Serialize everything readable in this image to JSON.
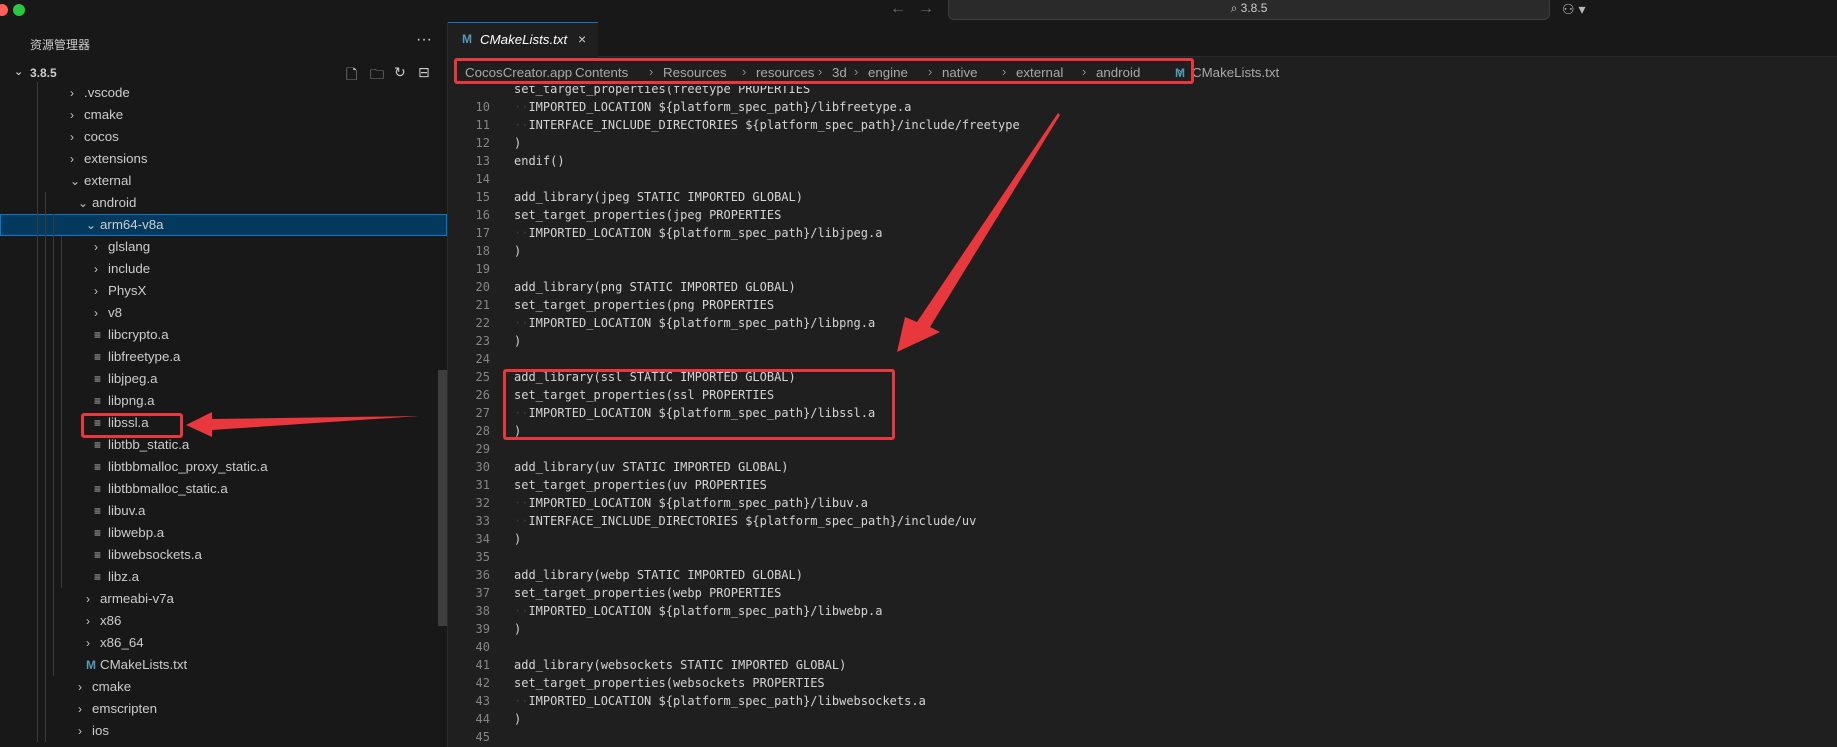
{
  "titlebar": {
    "search_text": "⌕ 3.8.5",
    "back_icon": "arrow-left-icon",
    "forward_icon": "arrow-right-icon",
    "copilot_icon": "copilot-icon",
    "copilot_glyph": "⚇ ▾"
  },
  "sidebar": {
    "header": "资源管理器",
    "more_glyph": "···",
    "root_label": "3.8.5",
    "toolbar_glyphs": [
      "🗋",
      "🗀",
      "↻",
      "⊟"
    ],
    "tree": [
      {
        "label": ".vscode",
        "type": "folder",
        "expanded": false
      },
      {
        "label": "cmake",
        "type": "folder",
        "expanded": false
      },
      {
        "label": "cocos",
        "type": "folder",
        "expanded": false
      },
      {
        "label": "extensions",
        "type": "folder",
        "expanded": false
      },
      {
        "label": "external",
        "type": "folder",
        "expanded": true
      },
      {
        "label": "android",
        "type": "folder",
        "expanded": true
      },
      {
        "label": "arm64-v8a",
        "type": "folder",
        "expanded": true,
        "selected": true
      },
      {
        "label": "glslang",
        "type": "folder",
        "expanded": false
      },
      {
        "label": "include",
        "type": "folder",
        "expanded": false
      },
      {
        "label": "PhysX",
        "type": "folder",
        "expanded": false
      },
      {
        "label": "v8",
        "type": "folder",
        "expanded": false
      },
      {
        "label": "libcrypto.a",
        "type": "file"
      },
      {
        "label": "libfreetype.a",
        "type": "file"
      },
      {
        "label": "libjpeg.a",
        "type": "file"
      },
      {
        "label": "libpng.a",
        "type": "file"
      },
      {
        "label": "libssl.a",
        "type": "file"
      },
      {
        "label": "libtbb_static.a",
        "type": "file"
      },
      {
        "label": "libtbbmalloc_proxy_static.a",
        "type": "file"
      },
      {
        "label": "libtbbmalloc_static.a",
        "type": "file"
      },
      {
        "label": "libuv.a",
        "type": "file"
      },
      {
        "label": "libwebp.a",
        "type": "file"
      },
      {
        "label": "libwebsockets.a",
        "type": "file"
      },
      {
        "label": "libz.a",
        "type": "file"
      },
      {
        "label": "armeabi-v7a",
        "type": "folder",
        "expanded": false
      },
      {
        "label": "x86",
        "type": "folder",
        "expanded": false
      },
      {
        "label": "x86_64",
        "type": "folder",
        "expanded": false
      },
      {
        "label": "CMakeLists.txt",
        "type": "cmake"
      },
      {
        "label": "cmake",
        "type": "folder",
        "expanded": false
      },
      {
        "label": "emscripten",
        "type": "folder",
        "expanded": false
      },
      {
        "label": "ios",
        "type": "folder",
        "expanded": false
      }
    ]
  },
  "editor": {
    "tab": {
      "icon_glyph": "M",
      "label": "CMakeLists.txt",
      "close_glyph": "×"
    },
    "breadcrumb": [
      "CocosCreator.app",
      "Contents",
      "Resources",
      "resources",
      "3d",
      "engine",
      "native",
      "external",
      "android",
      "CMakeLists.txt"
    ],
    "breadcrumb_sep": "›",
    "breadcrumb_file_icon": "M",
    "lines": [
      {
        "num": "",
        "indent": false,
        "text": "set_target_properties(freetype PROPERTIES"
      },
      {
        "num": "10",
        "indent": true,
        "text": "IMPORTED_LOCATION ${platform_spec_path}/libfreetype.a"
      },
      {
        "num": "11",
        "indent": true,
        "text": "INTERFACE_INCLUDE_DIRECTORIES ${platform_spec_path}/include/freetype"
      },
      {
        "num": "12",
        "indent": false,
        "text": ")"
      },
      {
        "num": "13",
        "indent": false,
        "text": "endif()"
      },
      {
        "num": "14",
        "indent": false,
        "text": ""
      },
      {
        "num": "15",
        "indent": false,
        "text": "add_library(jpeg STATIC IMPORTED GLOBAL)"
      },
      {
        "num": "16",
        "indent": false,
        "text": "set_target_properties(jpeg PROPERTIES"
      },
      {
        "num": "17",
        "indent": true,
        "text": "IMPORTED_LOCATION ${platform_spec_path}/libjpeg.a"
      },
      {
        "num": "18",
        "indent": false,
        "text": ")"
      },
      {
        "num": "19",
        "indent": false,
        "text": ""
      },
      {
        "num": "20",
        "indent": false,
        "text": "add_library(png STATIC IMPORTED GLOBAL)"
      },
      {
        "num": "21",
        "indent": false,
        "text": "set_target_properties(png PROPERTIES"
      },
      {
        "num": "22",
        "indent": true,
        "text": "IMPORTED_LOCATION ${platform_spec_path}/libpng.a"
      },
      {
        "num": "23",
        "indent": false,
        "text": ")"
      },
      {
        "num": "24",
        "indent": false,
        "text": ""
      },
      {
        "num": "25",
        "indent": false,
        "text": "add_library(ssl STATIC IMPORTED GLOBAL)"
      },
      {
        "num": "26",
        "indent": false,
        "text": "set_target_properties(ssl PROPERTIES"
      },
      {
        "num": "27",
        "indent": true,
        "text": "IMPORTED_LOCATION ${platform_spec_path}/libssl.a"
      },
      {
        "num": "28",
        "indent": false,
        "text": ")"
      },
      {
        "num": "29",
        "indent": false,
        "text": ""
      },
      {
        "num": "30",
        "indent": false,
        "text": "add_library(uv STATIC IMPORTED GLOBAL)"
      },
      {
        "num": "31",
        "indent": false,
        "text": "set_target_properties(uv PROPERTIES"
      },
      {
        "num": "32",
        "indent": true,
        "text": "IMPORTED_LOCATION ${platform_spec_path}/libuv.a"
      },
      {
        "num": "33",
        "indent": true,
        "text": "INTERFACE_INCLUDE_DIRECTORIES ${platform_spec_path}/include/uv"
      },
      {
        "num": "34",
        "indent": false,
        "text": ")"
      },
      {
        "num": "35",
        "indent": false,
        "text": ""
      },
      {
        "num": "36",
        "indent": false,
        "text": "add_library(webp STATIC IMPORTED GLOBAL)"
      },
      {
        "num": "37",
        "indent": false,
        "text": "set_target_properties(webp PROPERTIES"
      },
      {
        "num": "38",
        "indent": true,
        "text": "IMPORTED_LOCATION ${platform_spec_path}/libwebp.a"
      },
      {
        "num": "39",
        "indent": false,
        "text": ")"
      },
      {
        "num": "40",
        "indent": false,
        "text": ""
      },
      {
        "num": "41",
        "indent": false,
        "text": "add_library(websockets STATIC IMPORTED GLOBAL)"
      },
      {
        "num": "42",
        "indent": false,
        "text": "set_target_properties(websockets PROPERTIES"
      },
      {
        "num": "43",
        "indent": true,
        "text": "IMPORTED_LOCATION ${platform_spec_path}/libwebsockets.a"
      },
      {
        "num": "44",
        "indent": false,
        "text": ")"
      },
      {
        "num": "45",
        "indent": false,
        "text": ""
      }
    ]
  },
  "colors": {
    "annotation_red": "#e8373d",
    "selection_bg": "#04395e",
    "accent_blue": "#0078d4",
    "traffic_red": "#ff5f57",
    "traffic_green": "#28c840"
  }
}
